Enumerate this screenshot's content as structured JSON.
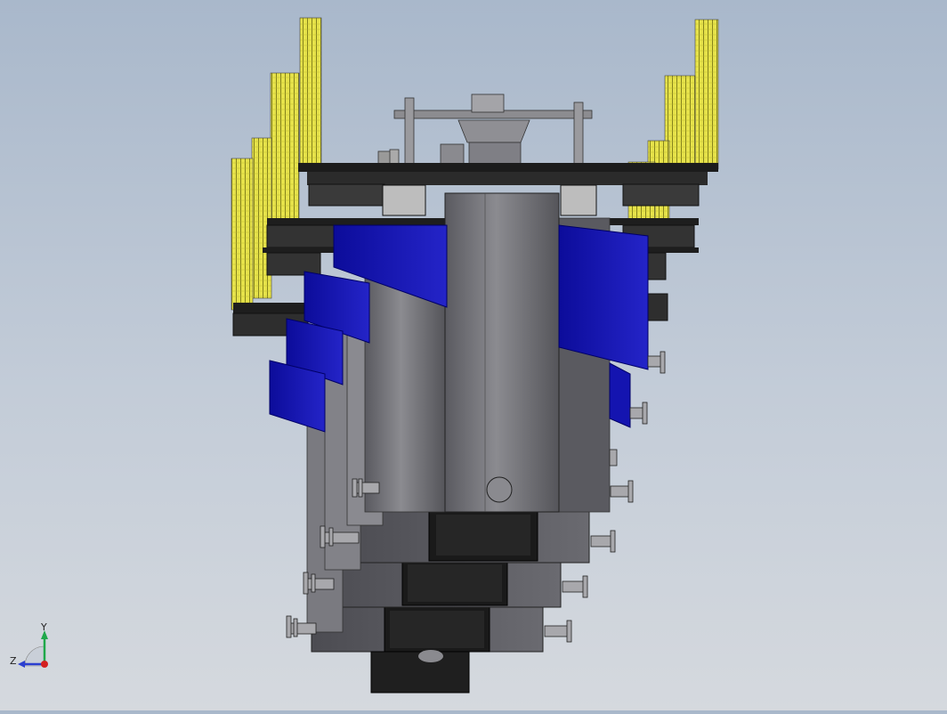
{
  "viewport": {
    "background_top": "#a9b8cb",
    "background_bottom": "#d5d9de",
    "model_colors": {
      "body_gray": "#6e6e73",
      "body_gray_light": "#8a8a8f",
      "panel_blue": "#1010a8",
      "fence_yellow": "#e8e84a",
      "frame_black": "#1a1a1a",
      "block_black": "#222222"
    }
  },
  "triad": {
    "y_label": "Y",
    "z_label": "Z",
    "y_color": "#1fa84a",
    "z_color": "#2b3fd0",
    "origin_color": "#d42020"
  }
}
